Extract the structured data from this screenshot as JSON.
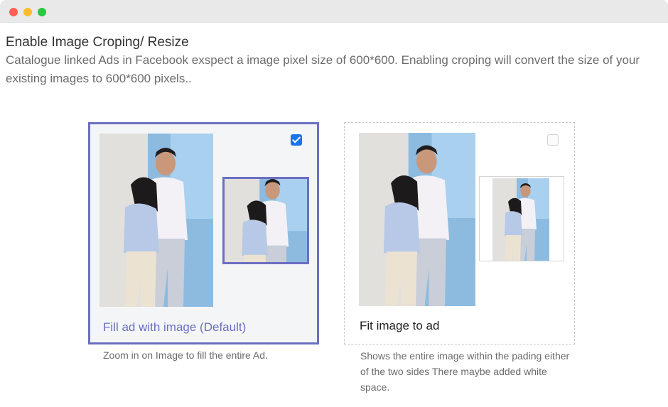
{
  "window": {
    "controls": [
      "close",
      "minimize",
      "maximize"
    ]
  },
  "header": {
    "title": "Enable Image Croping/ Resize",
    "description": "Catalogue linked Ads in Facebook exspect a image pixel size of 600*600. Enabling croping will convert the size of your existing images to 600*600 pixels.."
  },
  "options": {
    "fill": {
      "label": "Fill ad with image (Default)",
      "note": "Zoom in on Image to fill the entire Ad.",
      "checked": true
    },
    "fit": {
      "label": "Fit image to ad",
      "note": "Shows the entire image within the pading either of the two sides There maybe added white space.",
      "checked": false
    }
  },
  "colors": {
    "accent": "#6c6fc0",
    "checkbox_checked": "#1a73e8",
    "photo_wall": "#7fb1d8"
  }
}
